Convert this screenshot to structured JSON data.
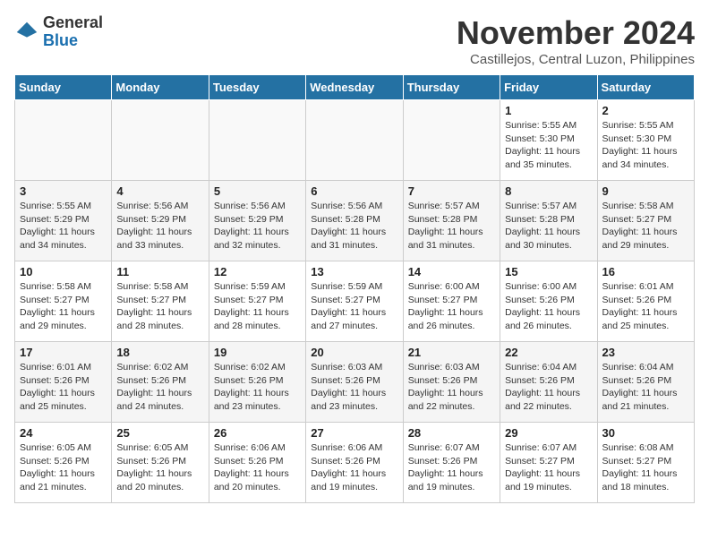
{
  "logo": {
    "general": "General",
    "blue": "Blue"
  },
  "title": "November 2024",
  "location": "Castillejos, Central Luzon, Philippines",
  "days_of_week": [
    "Sunday",
    "Monday",
    "Tuesday",
    "Wednesday",
    "Thursday",
    "Friday",
    "Saturday"
  ],
  "weeks": [
    [
      {
        "day": "",
        "info": ""
      },
      {
        "day": "",
        "info": ""
      },
      {
        "day": "",
        "info": ""
      },
      {
        "day": "",
        "info": ""
      },
      {
        "day": "",
        "info": ""
      },
      {
        "day": "1",
        "info": "Sunrise: 5:55 AM\nSunset: 5:30 PM\nDaylight: 11 hours and 35 minutes."
      },
      {
        "day": "2",
        "info": "Sunrise: 5:55 AM\nSunset: 5:30 PM\nDaylight: 11 hours and 34 minutes."
      }
    ],
    [
      {
        "day": "3",
        "info": "Sunrise: 5:55 AM\nSunset: 5:29 PM\nDaylight: 11 hours and 34 minutes."
      },
      {
        "day": "4",
        "info": "Sunrise: 5:56 AM\nSunset: 5:29 PM\nDaylight: 11 hours and 33 minutes."
      },
      {
        "day": "5",
        "info": "Sunrise: 5:56 AM\nSunset: 5:29 PM\nDaylight: 11 hours and 32 minutes."
      },
      {
        "day": "6",
        "info": "Sunrise: 5:56 AM\nSunset: 5:28 PM\nDaylight: 11 hours and 31 minutes."
      },
      {
        "day": "7",
        "info": "Sunrise: 5:57 AM\nSunset: 5:28 PM\nDaylight: 11 hours and 31 minutes."
      },
      {
        "day": "8",
        "info": "Sunrise: 5:57 AM\nSunset: 5:28 PM\nDaylight: 11 hours and 30 minutes."
      },
      {
        "day": "9",
        "info": "Sunrise: 5:58 AM\nSunset: 5:27 PM\nDaylight: 11 hours and 29 minutes."
      }
    ],
    [
      {
        "day": "10",
        "info": "Sunrise: 5:58 AM\nSunset: 5:27 PM\nDaylight: 11 hours and 29 minutes."
      },
      {
        "day": "11",
        "info": "Sunrise: 5:58 AM\nSunset: 5:27 PM\nDaylight: 11 hours and 28 minutes."
      },
      {
        "day": "12",
        "info": "Sunrise: 5:59 AM\nSunset: 5:27 PM\nDaylight: 11 hours and 28 minutes."
      },
      {
        "day": "13",
        "info": "Sunrise: 5:59 AM\nSunset: 5:27 PM\nDaylight: 11 hours and 27 minutes."
      },
      {
        "day": "14",
        "info": "Sunrise: 6:00 AM\nSunset: 5:27 PM\nDaylight: 11 hours and 26 minutes."
      },
      {
        "day": "15",
        "info": "Sunrise: 6:00 AM\nSunset: 5:26 PM\nDaylight: 11 hours and 26 minutes."
      },
      {
        "day": "16",
        "info": "Sunrise: 6:01 AM\nSunset: 5:26 PM\nDaylight: 11 hours and 25 minutes."
      }
    ],
    [
      {
        "day": "17",
        "info": "Sunrise: 6:01 AM\nSunset: 5:26 PM\nDaylight: 11 hours and 25 minutes."
      },
      {
        "day": "18",
        "info": "Sunrise: 6:02 AM\nSunset: 5:26 PM\nDaylight: 11 hours and 24 minutes."
      },
      {
        "day": "19",
        "info": "Sunrise: 6:02 AM\nSunset: 5:26 PM\nDaylight: 11 hours and 23 minutes."
      },
      {
        "day": "20",
        "info": "Sunrise: 6:03 AM\nSunset: 5:26 PM\nDaylight: 11 hours and 23 minutes."
      },
      {
        "day": "21",
        "info": "Sunrise: 6:03 AM\nSunset: 5:26 PM\nDaylight: 11 hours and 22 minutes."
      },
      {
        "day": "22",
        "info": "Sunrise: 6:04 AM\nSunset: 5:26 PM\nDaylight: 11 hours and 22 minutes."
      },
      {
        "day": "23",
        "info": "Sunrise: 6:04 AM\nSunset: 5:26 PM\nDaylight: 11 hours and 21 minutes."
      }
    ],
    [
      {
        "day": "24",
        "info": "Sunrise: 6:05 AM\nSunset: 5:26 PM\nDaylight: 11 hours and 21 minutes."
      },
      {
        "day": "25",
        "info": "Sunrise: 6:05 AM\nSunset: 5:26 PM\nDaylight: 11 hours and 20 minutes."
      },
      {
        "day": "26",
        "info": "Sunrise: 6:06 AM\nSunset: 5:26 PM\nDaylight: 11 hours and 20 minutes."
      },
      {
        "day": "27",
        "info": "Sunrise: 6:06 AM\nSunset: 5:26 PM\nDaylight: 11 hours and 19 minutes."
      },
      {
        "day": "28",
        "info": "Sunrise: 6:07 AM\nSunset: 5:26 PM\nDaylight: 11 hours and 19 minutes."
      },
      {
        "day": "29",
        "info": "Sunrise: 6:07 AM\nSunset: 5:27 PM\nDaylight: 11 hours and 19 minutes."
      },
      {
        "day": "30",
        "info": "Sunrise: 6:08 AM\nSunset: 5:27 PM\nDaylight: 11 hours and 18 minutes."
      }
    ]
  ]
}
